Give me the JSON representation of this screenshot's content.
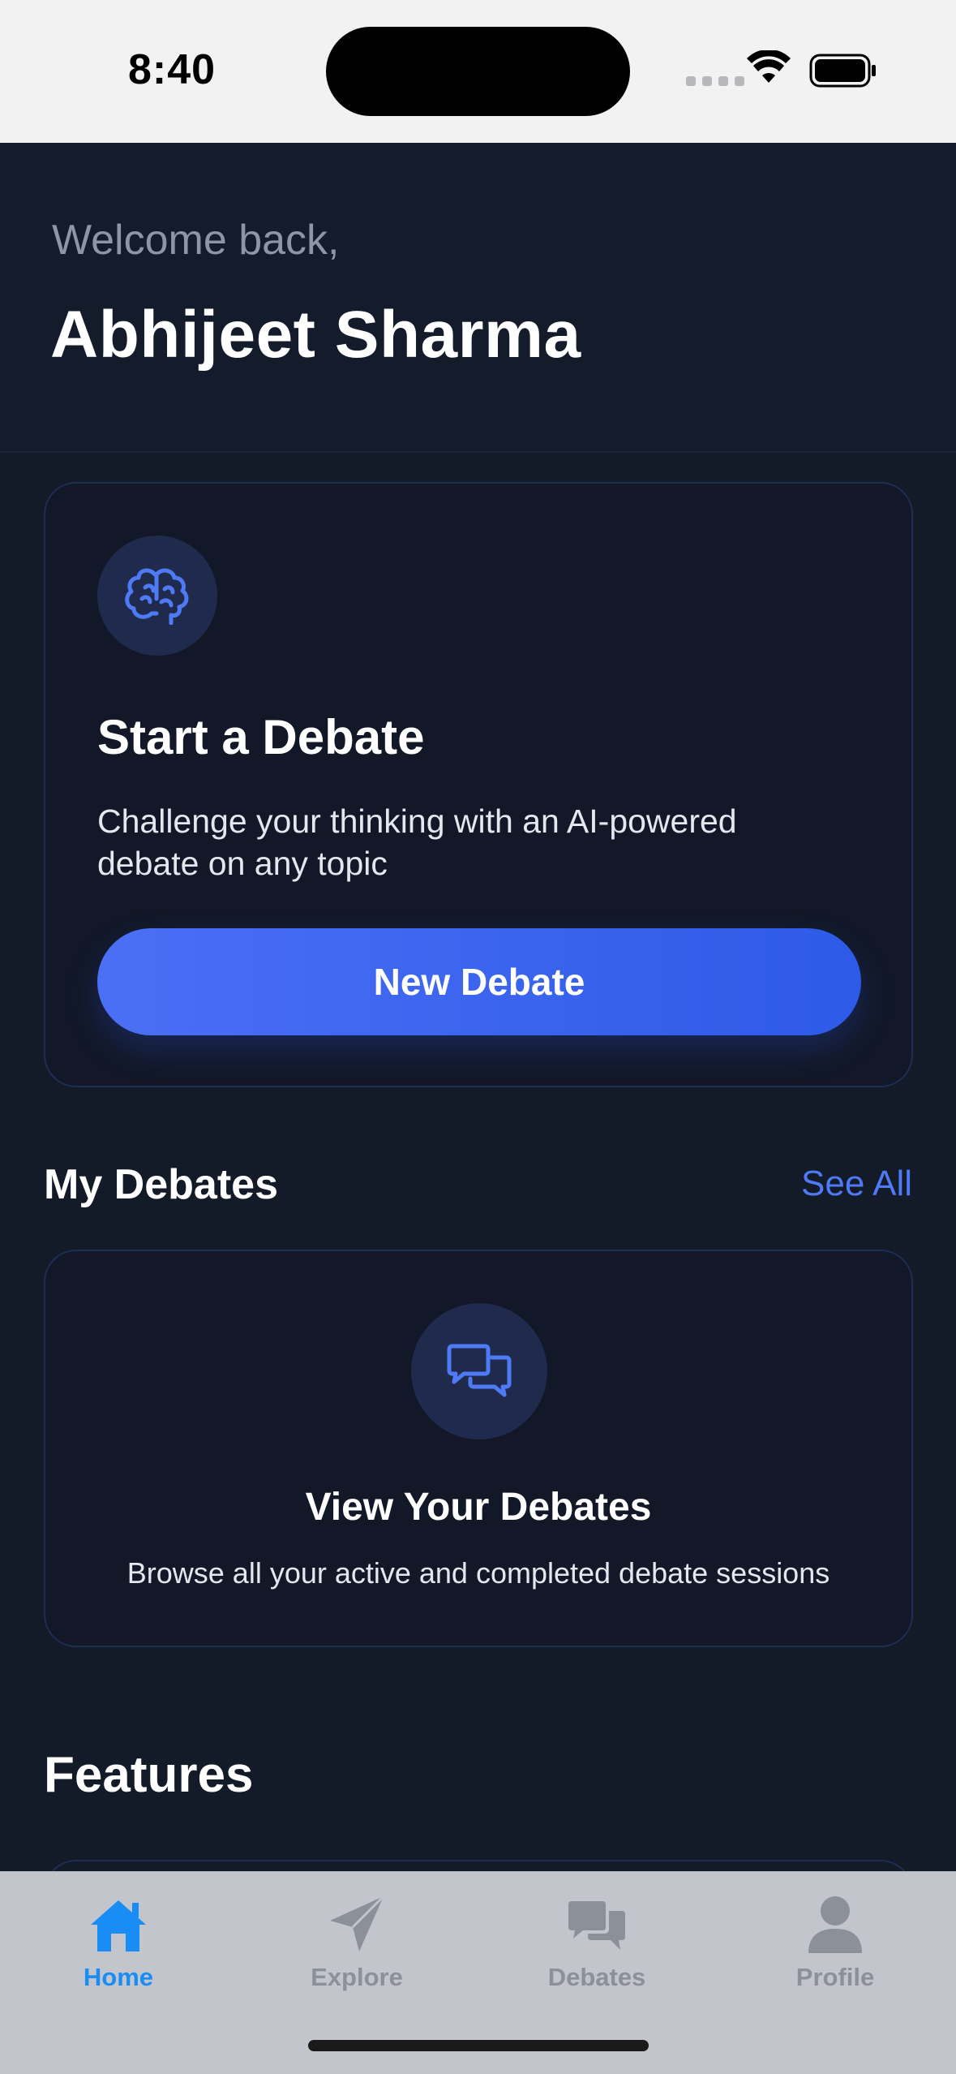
{
  "status_bar": {
    "time": "8:40"
  },
  "header": {
    "welcome": "Welcome back,",
    "user_name": "Abhijeet Sharma"
  },
  "start_card": {
    "icon": "brain-icon",
    "title": "Start a Debate",
    "description": "Challenge your thinking with an AI-powered debate on any topic",
    "button_label": "New Debate"
  },
  "my_debates": {
    "section_title": "My Debates",
    "see_all": "See All",
    "card": {
      "icon": "chat-bubbles-icon",
      "title": "View Your Debates",
      "description": "Browse all your active and completed debate sessions"
    }
  },
  "features": {
    "section_title": "Features"
  },
  "tab_bar": {
    "tabs": [
      {
        "label": "Home",
        "icon": "home-icon",
        "active": true
      },
      {
        "label": "Explore",
        "icon": "paper-plane-icon",
        "active": false
      },
      {
        "label": "Debates",
        "icon": "chat-bubbles-icon",
        "active": false
      },
      {
        "label": "Profile",
        "icon": "person-icon",
        "active": false
      }
    ]
  },
  "colors": {
    "background": "#131a28",
    "accent": "#3b63ee",
    "link": "#4f7af5",
    "active_tab": "#1a8cf5",
    "inactive_tab": "#8c9099"
  }
}
